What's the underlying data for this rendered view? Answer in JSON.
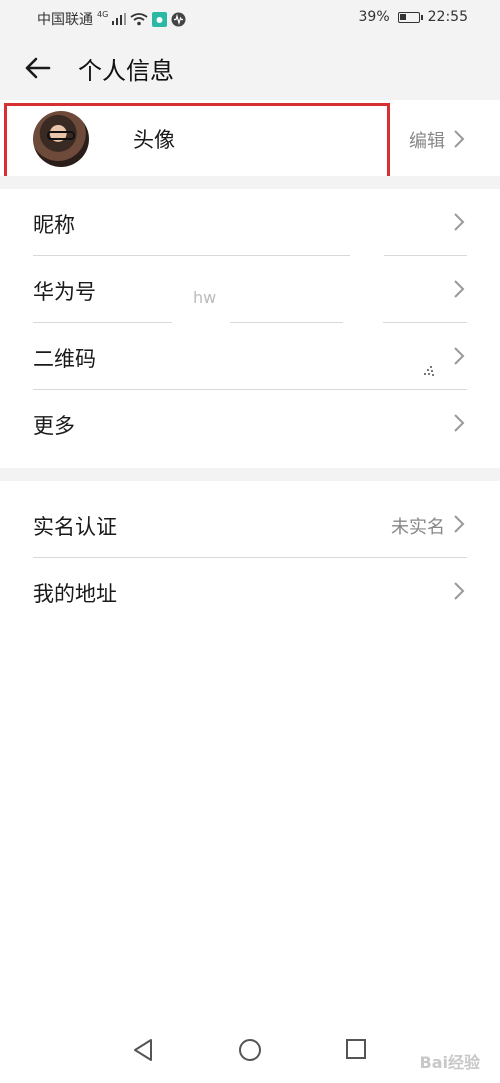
{
  "status_bar": {
    "carrier": "中国联通",
    "network": "4G",
    "battery_percent": "39%",
    "battery_level": 0.39,
    "time": "22:55"
  },
  "header": {
    "title": "个人信息",
    "back_icon": "arrow-left-icon"
  },
  "avatar_row": {
    "label": "头像",
    "edit_label": "编辑",
    "highlight_color": "#d73033"
  },
  "group1": [
    {
      "label": "昵称",
      "value": ""
    },
    {
      "label": "华为号",
      "value": "hw"
    },
    {
      "label": "二维码",
      "value": ""
    },
    {
      "label": "更多",
      "value": ""
    }
  ],
  "group2": [
    {
      "label": "实名认证",
      "value": "未实名"
    },
    {
      "label": "我的地址",
      "value": ""
    }
  ],
  "nav_bar": {
    "icons": [
      "nav-back-icon",
      "nav-home-icon",
      "nav-recents-icon"
    ]
  },
  "watermark": "Bai经验"
}
